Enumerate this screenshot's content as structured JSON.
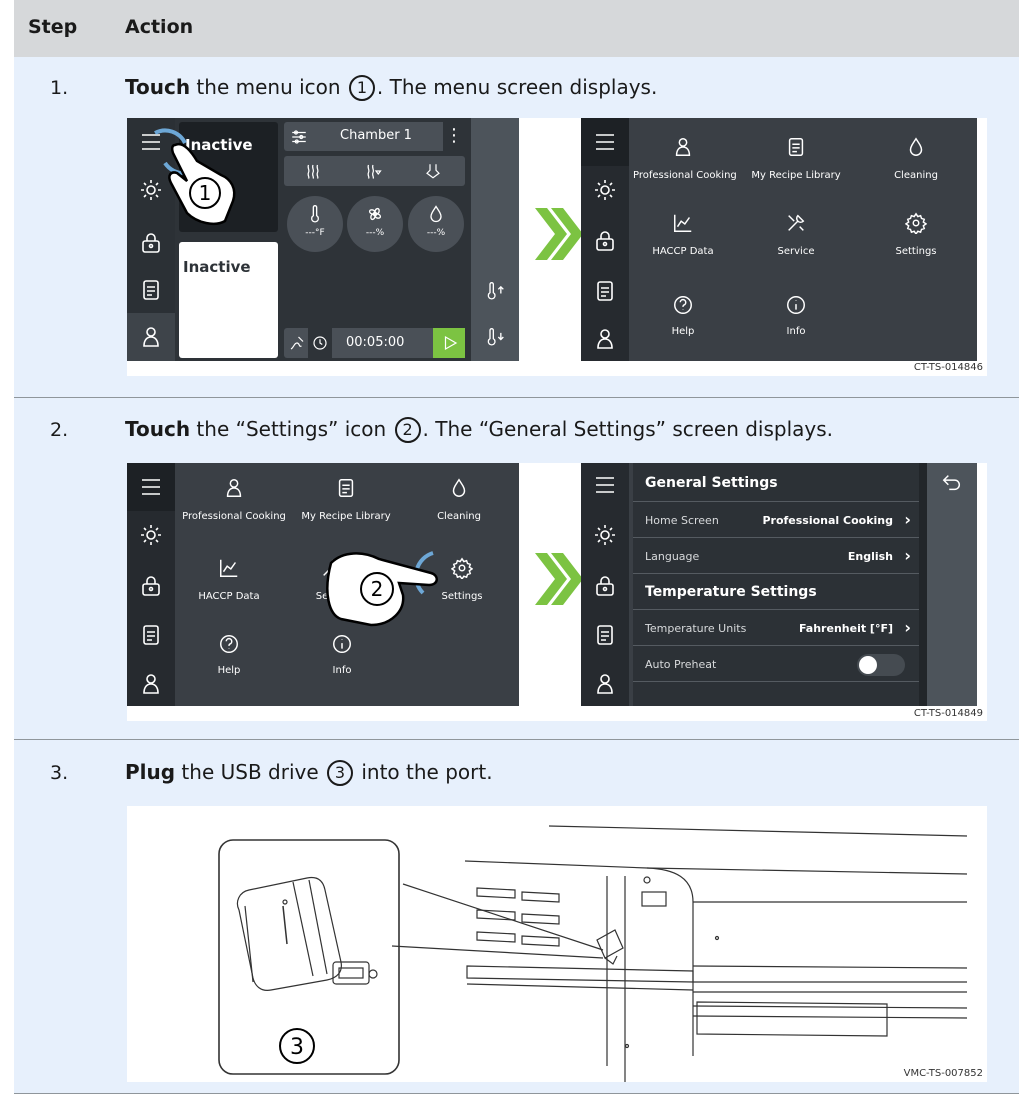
{
  "header": {
    "step": "Step",
    "action": "Action"
  },
  "steps": [
    {
      "num": "1.",
      "verb": "Touch",
      "text_a": " the menu icon ",
      "callout": "1",
      "text_b": ". The menu screen displays.",
      "figure_code": "CT-TS-014846"
    },
    {
      "num": "2.",
      "verb": "Touch",
      "text_a": " the “Settings” icon ",
      "callout": "2",
      "text_b": ". The “General Settings” screen displays.",
      "figure_code": "CT-TS-014849"
    },
    {
      "num": "3.",
      "verb": "Plug",
      "text_a": " the USB drive ",
      "callout": "3",
      "text_b": " into the port.",
      "figure_code": "VMC-TS-007852"
    }
  ],
  "oven_screen": {
    "panel_top_status": "Inactive",
    "panel_bottom_status": "Inactive",
    "chamber": "Chamber 1",
    "temp_readout": "---°F",
    "fan_readout": "---%",
    "humidity_readout": "---%",
    "timer": "00:05:00",
    "callout": "1"
  },
  "menu_items": [
    {
      "label": "Professional Cooking",
      "icon": "chef-icon"
    },
    {
      "label": "My Recipe Library",
      "icon": "recipe-book-icon"
    },
    {
      "label": "Cleaning",
      "icon": "droplet-icon"
    },
    {
      "label": "HACCP Data",
      "icon": "chart-icon"
    },
    {
      "label": "Service",
      "icon": "tools-icon"
    },
    {
      "label": "Settings",
      "icon": "gear-icon"
    },
    {
      "label": "Help",
      "icon": "help-icon"
    },
    {
      "label": "Info",
      "icon": "info-icon"
    }
  ],
  "step2_menu": {
    "professional_cooking": "Professional Cooking",
    "recipe_library": "My Recipe Library",
    "cleaning": "Cleaning",
    "haccp": "HACCP Data",
    "service_partial": "Serv",
    "settings_partial": "Settings",
    "help": "Help",
    "info": "Info",
    "callout": "2"
  },
  "general_settings": {
    "section_general": "General Settings",
    "home_screen_label": "Home Screen",
    "home_screen_value": "Professional Cooking",
    "language_label": "Language",
    "language_value": "English",
    "section_temperature": "Temperature Settings",
    "temp_units_label": "Temperature Units",
    "temp_units_value": "Fahrenheit [°F]",
    "auto_preheat_label": "Auto Preheat",
    "auto_preheat_on": false
  },
  "usb_callout": "3",
  "colors": {
    "accent_green": "#7cc342",
    "screen_bg": "#3a3f45",
    "sidebar_bg": "#262a2f",
    "row_bg": "#e7f0fc",
    "header_bg": "#d6d8da"
  }
}
